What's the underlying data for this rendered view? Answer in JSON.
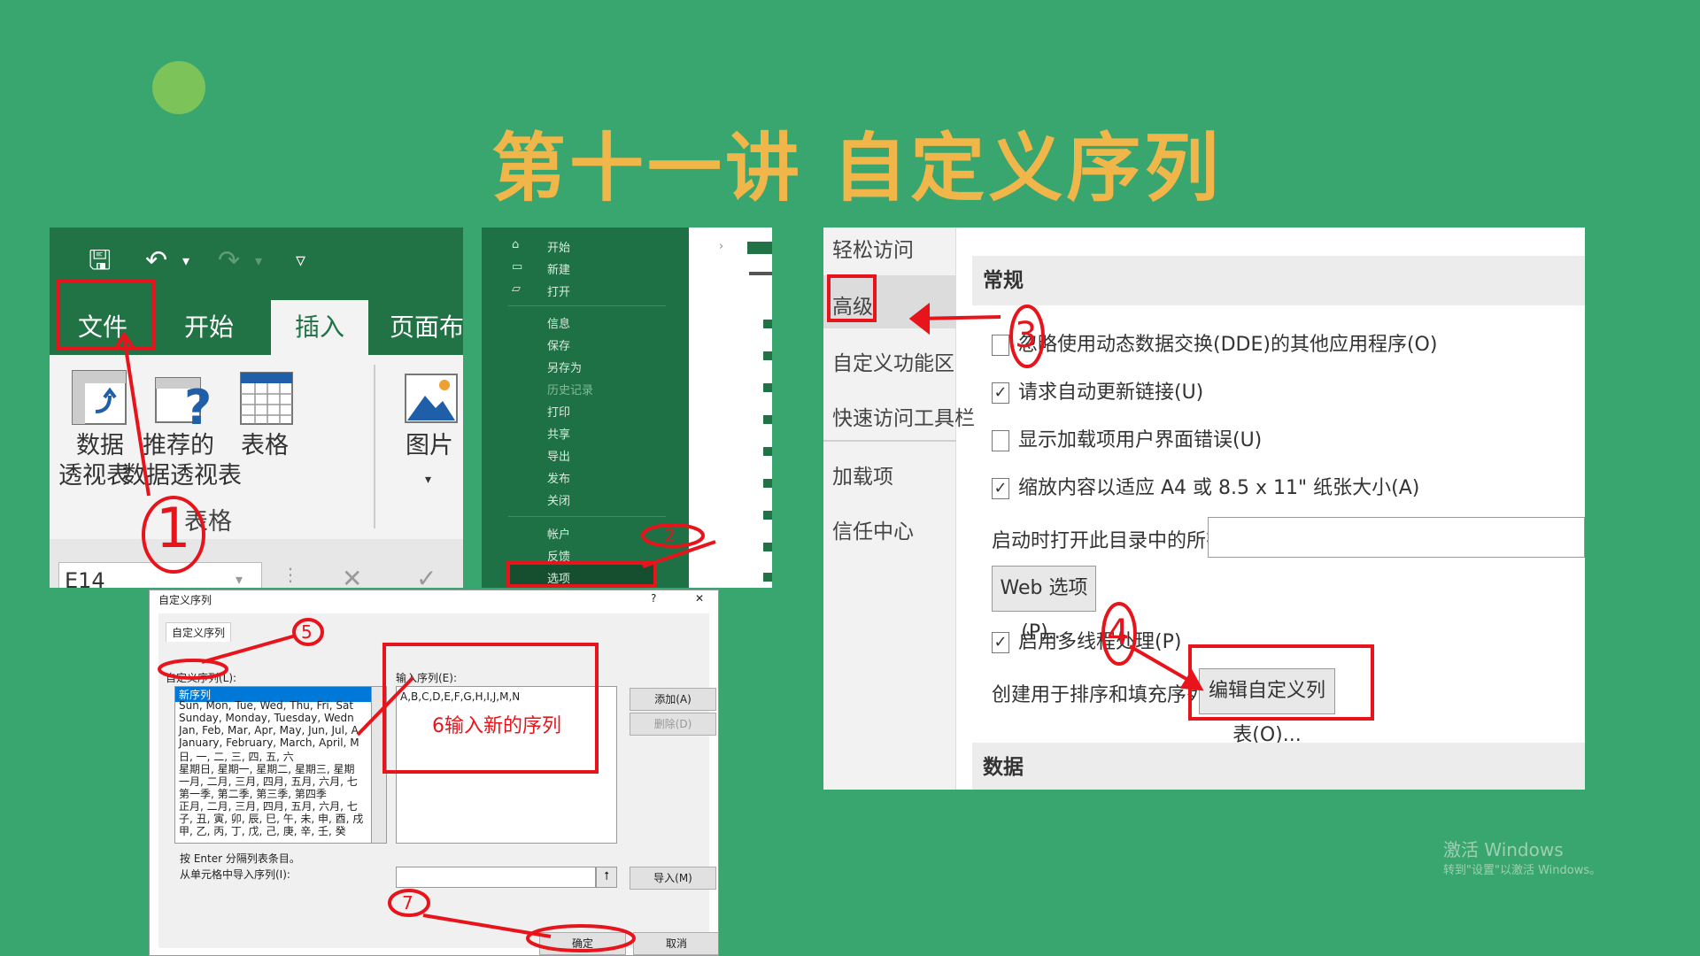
{
  "slide": {
    "title": "第十一讲 自定义序列"
  },
  "ribbon": {
    "tabs": [
      "文件",
      "开始",
      "插入",
      "页面布"
    ],
    "buttons": [
      {
        "label_1": "数据",
        "label_2": "透视表",
        "icon": "pivot-table-icon"
      },
      {
        "label_1": "推荐的",
        "label_2": "数据透视表",
        "icon": "recommended-pivot-icon"
      },
      {
        "label_1": "表格",
        "icon": "table-icon"
      },
      {
        "label_1": "图片",
        "icon": "picture-icon"
      }
    ],
    "group_label": "表格",
    "name_box": "E14"
  },
  "backstage": {
    "items": [
      "开始",
      "新建",
      "打开",
      "信息",
      "保存",
      "另存为",
      "历史记录",
      "打印",
      "共享",
      "导出",
      "发布",
      "关闭",
      "帐户",
      "反馈",
      "选项"
    ]
  },
  "options": {
    "nav": [
      "轻松访问",
      "高级",
      "自定义功能区",
      "快速访问工具栏",
      "加载项",
      "信任中心"
    ],
    "section_general": "常规",
    "section_data": "数据",
    "rows": [
      {
        "label": "忽略使用动态数据交换(DDE)的其他应用程序(O)",
        "checked": false
      },
      {
        "label": "请求自动更新链接(U)",
        "checked": true
      },
      {
        "label": "显示加载项用户界面错误(U)",
        "checked": false
      },
      {
        "label": "缩放内容以适应 A4 或 8.5 x 11\" 纸张大小(A)",
        "checked": true
      }
    ],
    "startup_label": "启动时打开此目录中的所有文件(L):",
    "web_button": "Web 选项(P)...",
    "multithread_label": "启用多线程处理(P)",
    "custom_list_label": "创建用于排序和填充序列的列表:",
    "edit_lists_button": "编辑自定义列表(O)..."
  },
  "dialog": {
    "title": "自定义序列",
    "help": "?",
    "close": "✕",
    "tab": "自定义序列",
    "list_label": "自定义序列(L):",
    "entries_label": "输入序列(E):",
    "lists": [
      "新序列",
      "Sun, Mon, Tue, Wed, Thu, Fri, Sat",
      "Sunday, Monday, Tuesday, Wedn",
      "Jan, Feb, Mar, Apr, May, Jun, Jul, A",
      "January, February, March, April, M",
      "日, 一, 二, 三, 四, 五, 六",
      "星期日, 星期一, 星期二, 星期三, 星期",
      "一月, 二月, 三月, 四月, 五月, 六月, 七",
      "第一季, 第二季, 第三季, 第四季",
      "正月, 二月, 三月, 四月, 五月, 六月, 七",
      "子, 丑, 寅, 卯, 辰, 巳, 午, 未, 申, 酉, 戌",
      "甲, 乙, 丙, 丁, 戊, 己, 庚, 辛, 壬, 癸"
    ],
    "entries_value": "A,B,C,D,E,F,G,H,I,J,M,N",
    "add_button": "添加(A)",
    "delete_button": "删除(D)",
    "hint": "按 Enter 分隔列表条目。",
    "import_label": "从单元格中导入序列(I):",
    "import_button": "导入(M)",
    "ok_button": "确定",
    "cancel_button": "取消"
  },
  "annotations": {
    "step1": "1",
    "step2": "2",
    "step3": "3",
    "step4": "4",
    "step5": "5",
    "step6": "6输入新的序列",
    "step7": "7",
    "color": "#e8141b"
  },
  "watermark": {
    "line1": "激活 Windows",
    "line2": "转到\"设置\"以激活 Windows。"
  }
}
